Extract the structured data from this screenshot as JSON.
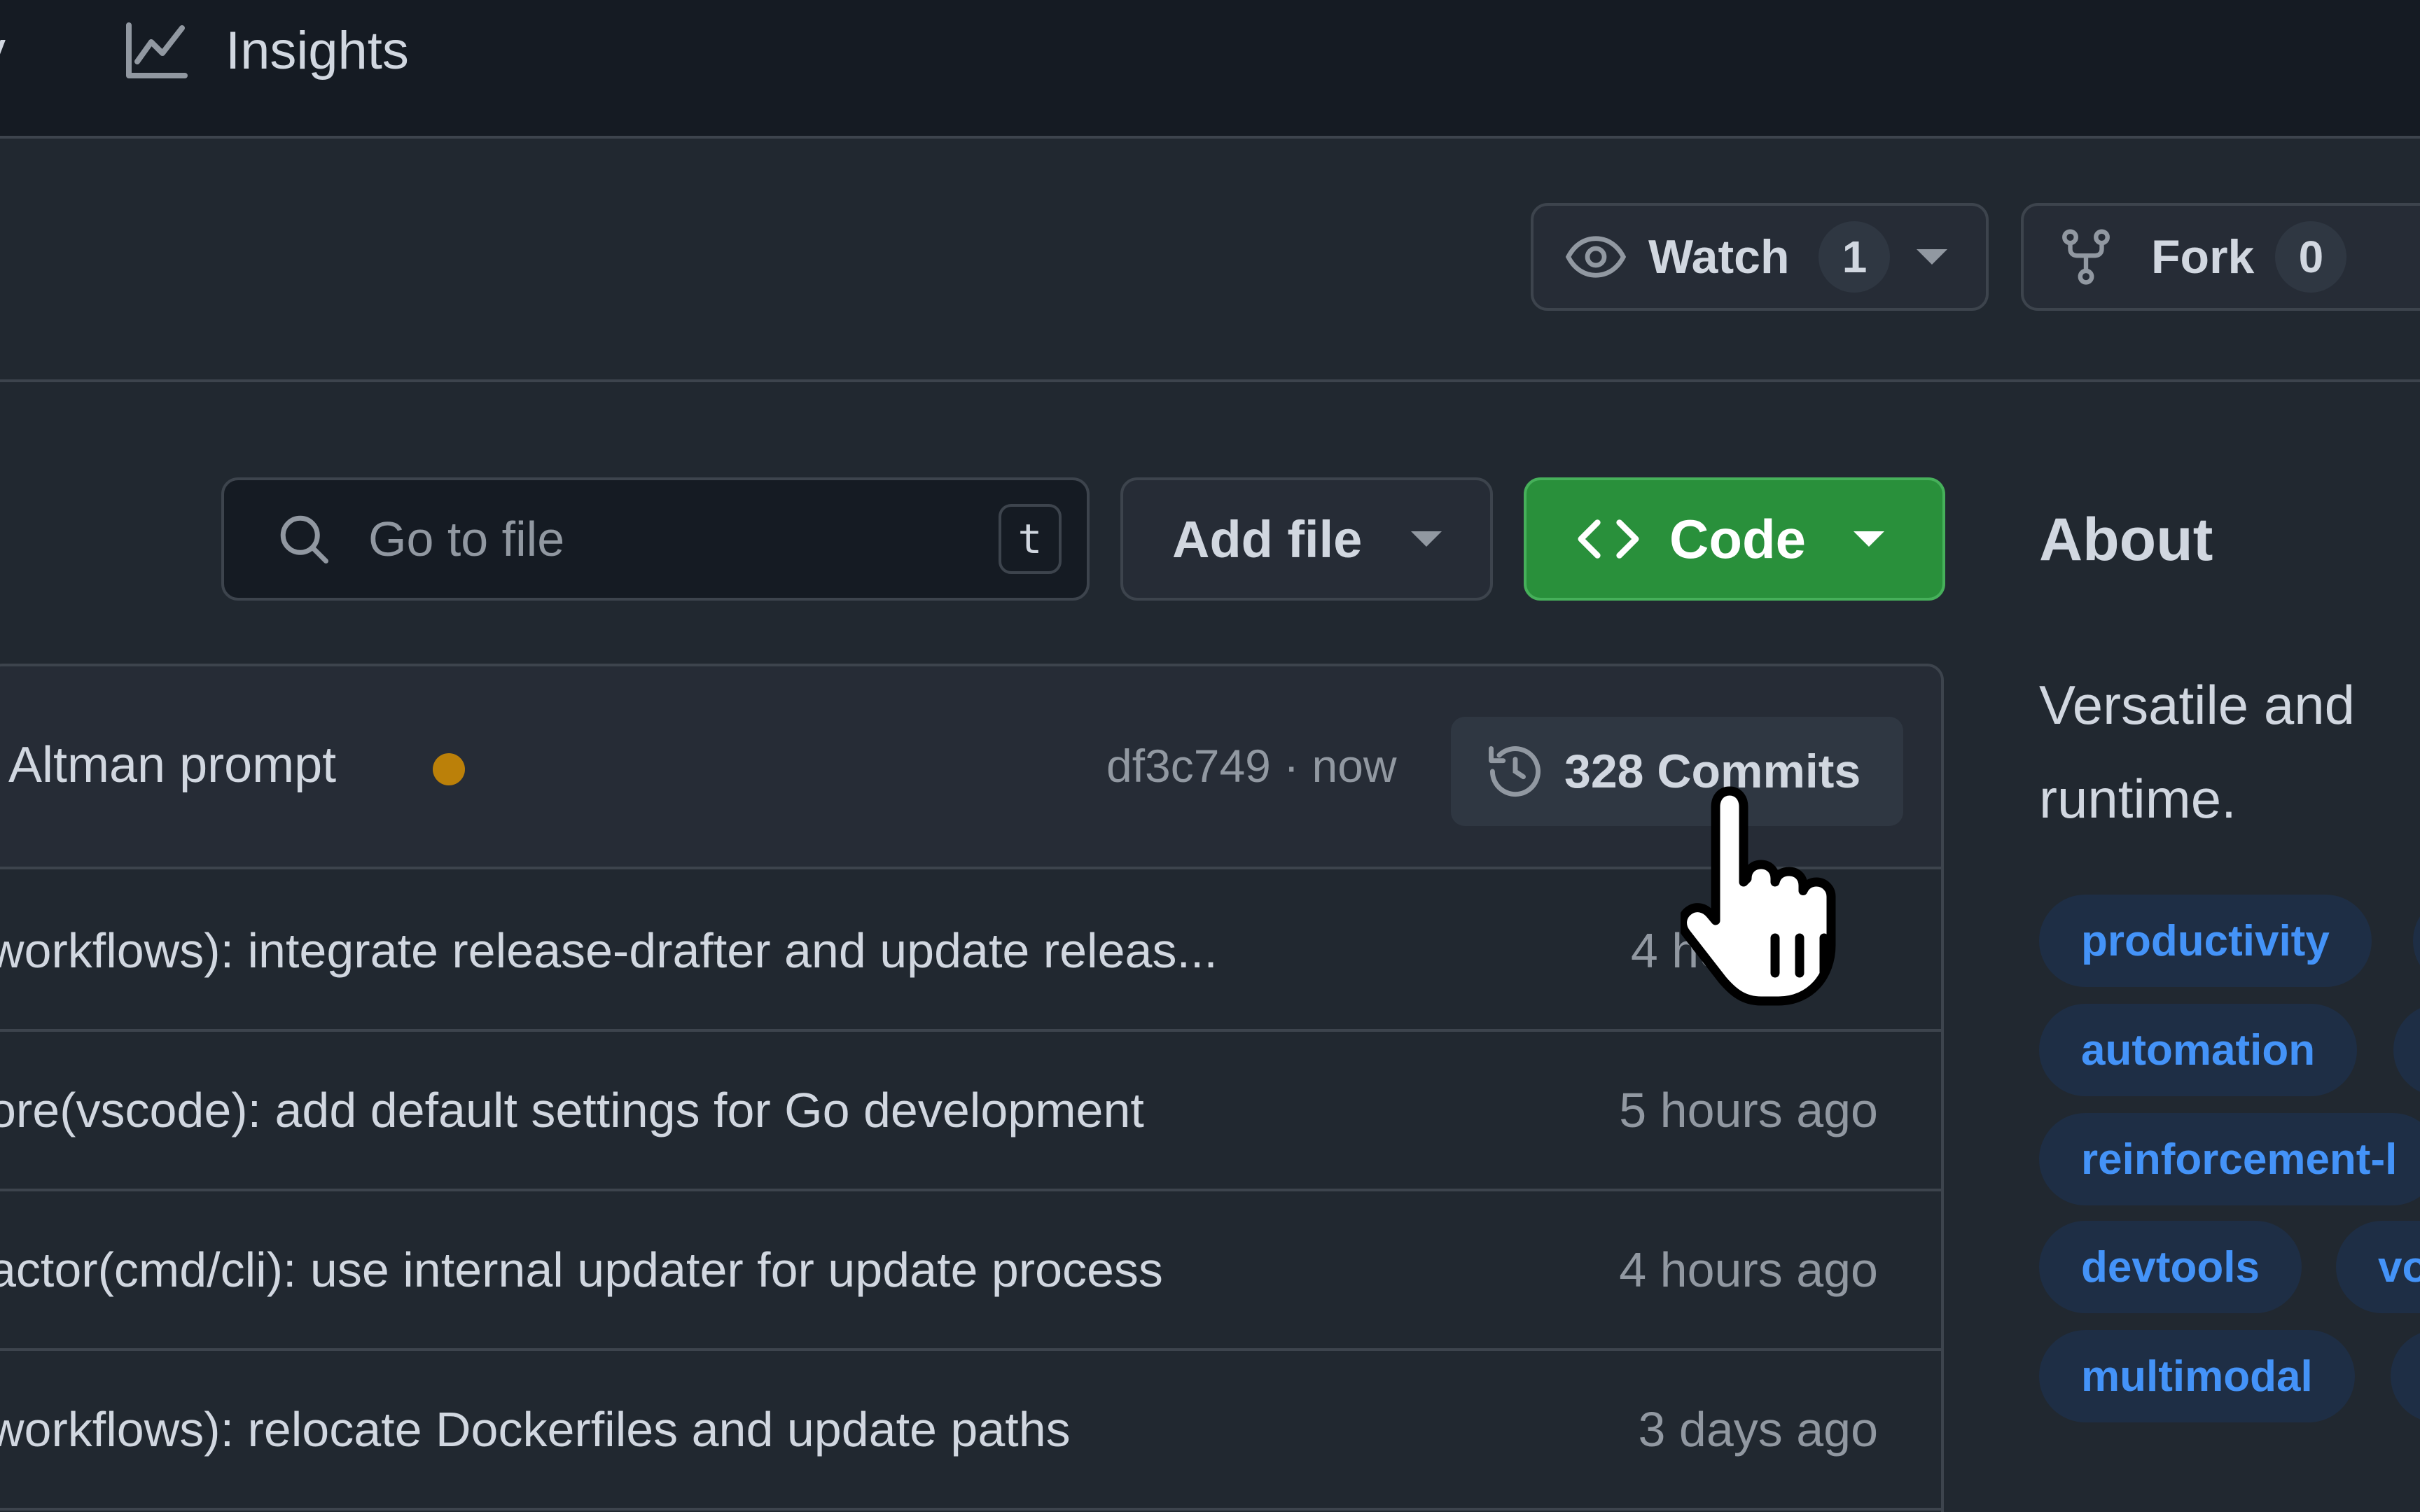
{
  "nav": {
    "partial_tab": "y",
    "insights_label": "Insights"
  },
  "repo_actions": {
    "watch_label": "Watch",
    "watch_count": "1",
    "fork_label": "Fork",
    "fork_count": "0"
  },
  "toolbar": {
    "search_placeholder": "Go to file",
    "search_shortcut": "t",
    "add_file_label": "Add file",
    "code_label": "Code"
  },
  "latest_commit": {
    "message": "Altman prompt",
    "sha_time": "df3c749 · now",
    "commits_label": "328 Commits",
    "status_color": "#bb8009"
  },
  "rows": [
    {
      "message": "workflows): integrate release-drafter and update releas...",
      "age": "4 hou"
    },
    {
      "message": "ore(vscode): add default settings for Go development",
      "age": "5 hours ago"
    },
    {
      "message": "actor(cmd/cli): use internal updater for update process",
      "age": "4 hours ago"
    },
    {
      "message": "workflows): relocate Dockerfiles and update paths",
      "age": "3 days ago"
    }
  ],
  "about": {
    "title": "About",
    "description_line1": "Versatile and",
    "description_line2": "runtime."
  },
  "topics": [
    "productivity",
    "automation",
    "reinforcement-l",
    "devtools",
    "vo",
    "multimodal"
  ],
  "colors": {
    "bg": "#212830",
    "nav_bg": "#151b23",
    "border": "#3d444d",
    "accent_green": "#29903b",
    "link_blue": "#4493f8"
  }
}
